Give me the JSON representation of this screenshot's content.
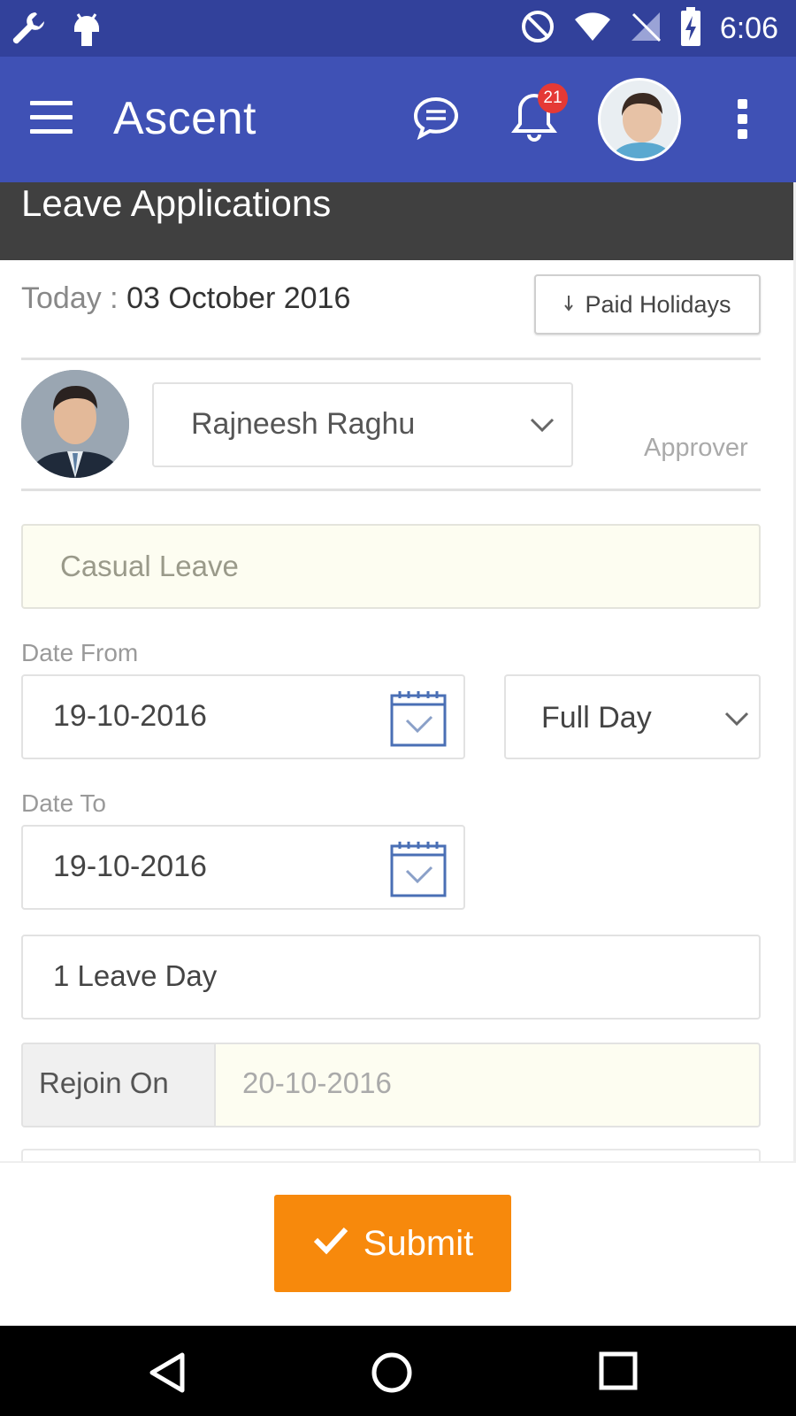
{
  "status_bar": {
    "time": "6:06",
    "icons": [
      "wrench-icon",
      "android-debug-icon",
      "do-not-disturb-icon",
      "wifi-icon",
      "no-signal-icon",
      "battery-charging-icon"
    ]
  },
  "app_bar": {
    "title": "Ascent",
    "notification_count": "21",
    "icons": [
      "menu-icon",
      "chat-icon",
      "bell-icon",
      "user-avatar",
      "more-vert-icon"
    ]
  },
  "section": {
    "title": "Leave Applications"
  },
  "form": {
    "today_label": "Today :",
    "today_value": "03 October 2016",
    "paid_holidays_label": "Paid Holidays",
    "approver_name": "Rajneesh Raghu",
    "approver_label": "Approver",
    "leave_type": "Casual Leave",
    "date_from_label": "Date From",
    "date_from_value": "19-10-2016",
    "day_span": "Full Day",
    "date_to_label": "Date To",
    "date_to_value": "19-10-2016",
    "leave_days": "1 Leave Day",
    "rejoin_label": "Rejoin On",
    "rejoin_value": "20-10-2016"
  },
  "footer": {
    "submit_label": "Submit"
  },
  "colors": {
    "status_bar": "#32419b",
    "app_bar": "#3f51b5",
    "section_header": "#404040",
    "submit": "#f7890c",
    "badge": "#e53935",
    "highlight_field": "#fdfdf1"
  }
}
